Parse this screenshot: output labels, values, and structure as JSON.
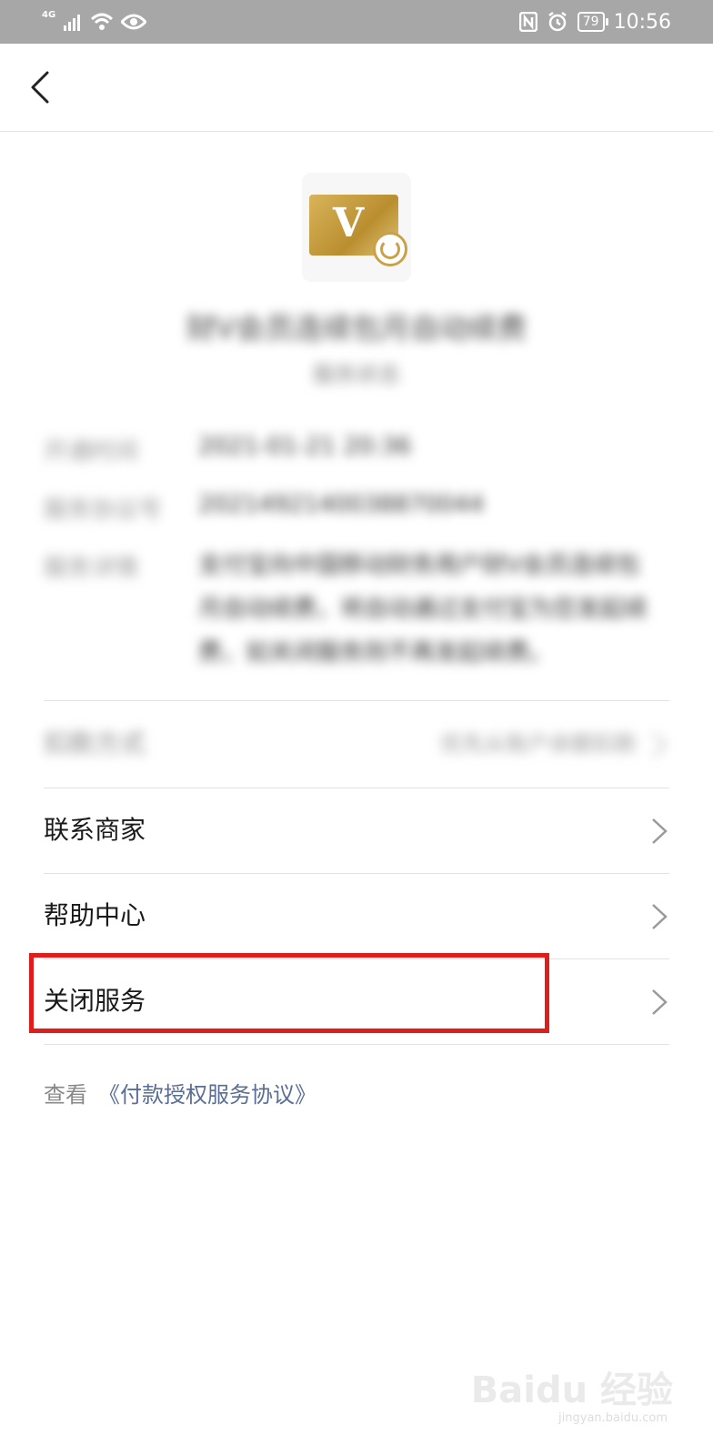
{
  "status_bar": {
    "network": "4G",
    "battery": "79",
    "time": "10:56"
  },
  "service": {
    "card_letter": "V",
    "title": "财V会员连续包月自动续费",
    "subtitle": "服务状态"
  },
  "info": [
    {
      "label": "开通时间",
      "value": "2021-01-21 20:36"
    },
    {
      "label": "服务协议号",
      "value": "2021492140038870044"
    },
    {
      "label": "服务详情",
      "value": "支付宝向中国移动财务用户财V会员连续包月自动续费，将自动通过支付宝为您发起续费，如关闭服务则不再发起续费。"
    }
  ],
  "deduction": {
    "label": "扣款方式",
    "value": "优先从账户余额扣款"
  },
  "menu": [
    {
      "label": "联系商家"
    },
    {
      "label": "帮助中心"
    },
    {
      "label": "关闭服务"
    }
  ],
  "agreement": {
    "prefix": "查看",
    "link": "《付款授权服务协议》"
  },
  "watermark": {
    "text": "Baidu 经验",
    "sub": "jingyan.baidu.com"
  }
}
